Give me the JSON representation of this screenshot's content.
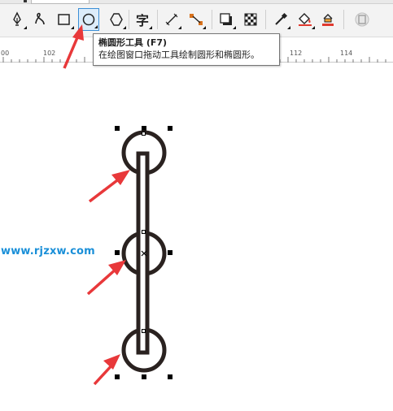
{
  "toolbar": {
    "tools": [
      {
        "name": "pen-tool",
        "icon": "pen-icon"
      },
      {
        "name": "artistic-media-tool",
        "icon": "artistic-media-icon"
      },
      {
        "name": "rectangle-tool",
        "icon": "rectangle-icon"
      },
      {
        "name": "ellipse-tool",
        "icon": "ellipse-icon",
        "active": true
      },
      {
        "name": "polygon-tool",
        "icon": "polygon-icon"
      },
      {
        "name": "text-tool",
        "icon": "text-icon",
        "glyph": "字"
      },
      {
        "name": "parallel-dimension-tool",
        "icon": "dimension-icon"
      },
      {
        "name": "connector-tool",
        "icon": "connector-icon"
      },
      {
        "name": "drop-shadow-tool",
        "icon": "drop-shadow-icon"
      },
      {
        "name": "transparency-tool",
        "icon": "transparency-icon"
      },
      {
        "name": "color-eyedropper-tool",
        "icon": "eyedropper-icon"
      },
      {
        "name": "interactive-fill-tool",
        "icon": "fill-bucket-icon"
      },
      {
        "name": "smart-fill-tool",
        "icon": "smart-fill-icon"
      },
      {
        "name": "overlay-button",
        "icon": "square-overlay-icon"
      }
    ],
    "accent_color": "#3c8fd6"
  },
  "tooltip": {
    "title": "椭圆形工具 (F7)",
    "description": "在绘图窗口拖动工具绘制圆形和椭圆形。"
  },
  "ruler": {
    "labels": [
      "00",
      "102",
      "112",
      "114"
    ]
  },
  "watermark": {
    "text": "www.rjzxw.com",
    "color": "#1a8fd8"
  },
  "colors": {
    "annotation_arrow": "#e8383a",
    "shape_stroke": "#2a2220"
  }
}
